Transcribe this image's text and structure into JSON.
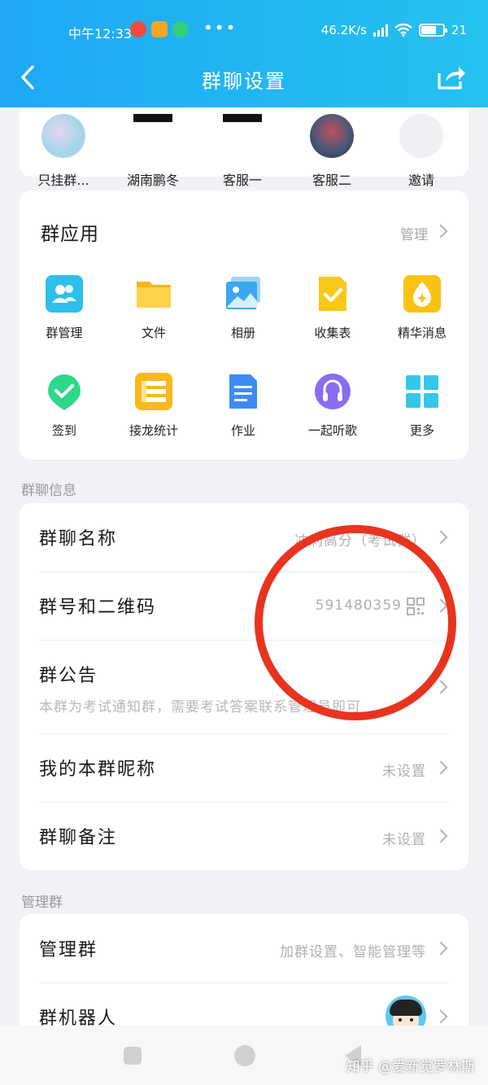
{
  "status_bar": {
    "time": "中午12:33",
    "dots": "•••",
    "network_speed": "46.2K/s",
    "battery_text": "21"
  },
  "header": {
    "title": "群聊设置"
  },
  "members": [
    {
      "name": "只挂群..."
    },
    {
      "name": "湖南鹏冬"
    },
    {
      "name": "客服一"
    },
    {
      "name": "客服二"
    },
    {
      "name": "邀请"
    }
  ],
  "group_apps": {
    "title": "群应用",
    "manage_label": "管理",
    "items": [
      {
        "label": "群管理",
        "icon": "group-manage-icon"
      },
      {
        "label": "文件",
        "icon": "folder-icon"
      },
      {
        "label": "相册",
        "icon": "album-icon"
      },
      {
        "label": "收集表",
        "icon": "form-icon"
      },
      {
        "label": "精华消息",
        "icon": "essence-icon"
      },
      {
        "label": "签到",
        "icon": "checkin-icon"
      },
      {
        "label": "接龙统计",
        "icon": "relay-icon"
      },
      {
        "label": "作业",
        "icon": "homework-icon"
      },
      {
        "label": "一起听歌",
        "icon": "music-icon"
      },
      {
        "label": "更多",
        "icon": "more-icon"
      }
    ]
  },
  "group_info": {
    "section_title": "群聊信息",
    "name_label": "群聊名称",
    "name_value": "冲刺高分（考试群）",
    "number_label": "群号和二维码",
    "number_value": "591480359",
    "notice_label": "群公告",
    "notice_text": "本群为考试通知群，需要考试答案联系管理员即可",
    "nickname_label": "我的本群昵称",
    "nickname_value": "未设置",
    "remark_label": "群聊备注",
    "remark_value": "未设置"
  },
  "manage_group": {
    "section_title": "管理群",
    "manage_label": "管理群",
    "manage_value": "加群设置、智能管理等",
    "robot_label": "群机器人"
  },
  "watermark": "知乎 @爱新觉罗林斯",
  "colors": {
    "header_start": "#1ea8f6",
    "header_end": "#24c1ef",
    "annotation_circle": "#e8341f"
  }
}
